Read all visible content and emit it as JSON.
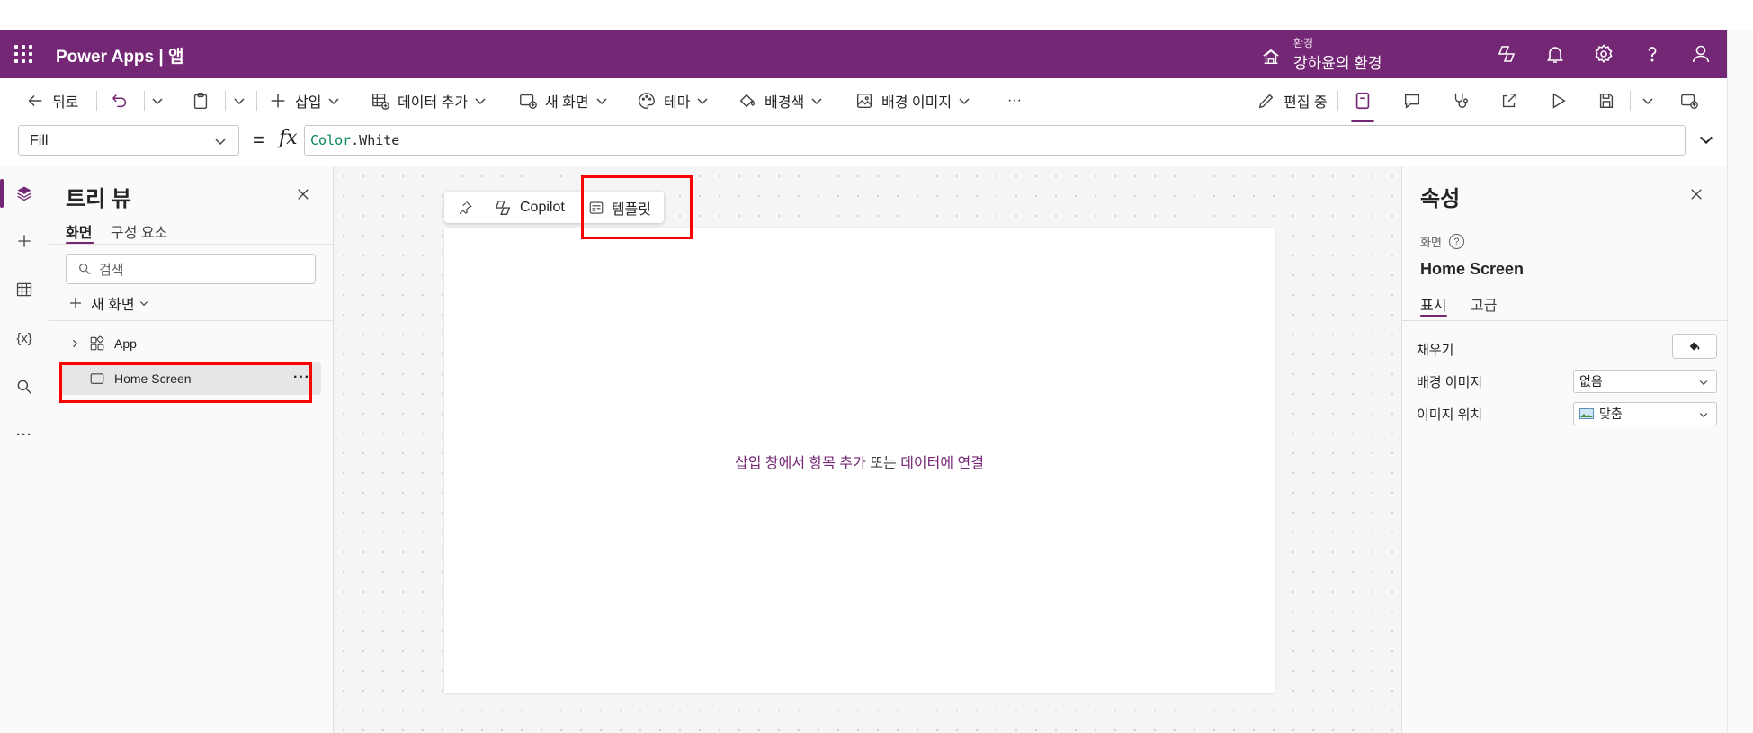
{
  "header": {
    "app_title": "Power Apps  |  앱",
    "environment_label": "환경",
    "environment_name": "강하윤의 환경",
    "brand_color": "#742774"
  },
  "toolbar": {
    "back": "뒤로",
    "insert": "삽입",
    "add_data": "데이터 추가",
    "new_screen": "새 화면",
    "theme": "테마",
    "background_color": "배경색",
    "background_image": "배경 이미지",
    "more": "···",
    "editing": "편집 중"
  },
  "formula_bar": {
    "property": "Fill",
    "equals": "=",
    "fx": "fx",
    "formula_keyword": "Color",
    "formula_rest": ".White"
  },
  "tree_view": {
    "title": "트리 뷰",
    "tab_screens": "화면",
    "tab_components": "구성 요소",
    "search_placeholder": "검색",
    "new_screen": "새 화면",
    "items": [
      {
        "label": "App"
      },
      {
        "label": "Home Screen",
        "more": "···"
      }
    ]
  },
  "canvas": {
    "copilot": "Copilot",
    "templates": "템플릿",
    "hint_part1": "삽입 창에서 항목 추가",
    "hint_part2": "또는",
    "hint_part3": "데이터에 연결"
  },
  "properties": {
    "title": "속성",
    "kind": "화면",
    "help": "?",
    "screen_name": "Home Screen",
    "tab_display": "표시",
    "tab_advanced": "고급",
    "fill_label": "채우기",
    "bg_image_label": "배경 이미지",
    "bg_image_value": "없음",
    "image_position_label": "이미지 위치",
    "image_position_value": "맞춤"
  }
}
